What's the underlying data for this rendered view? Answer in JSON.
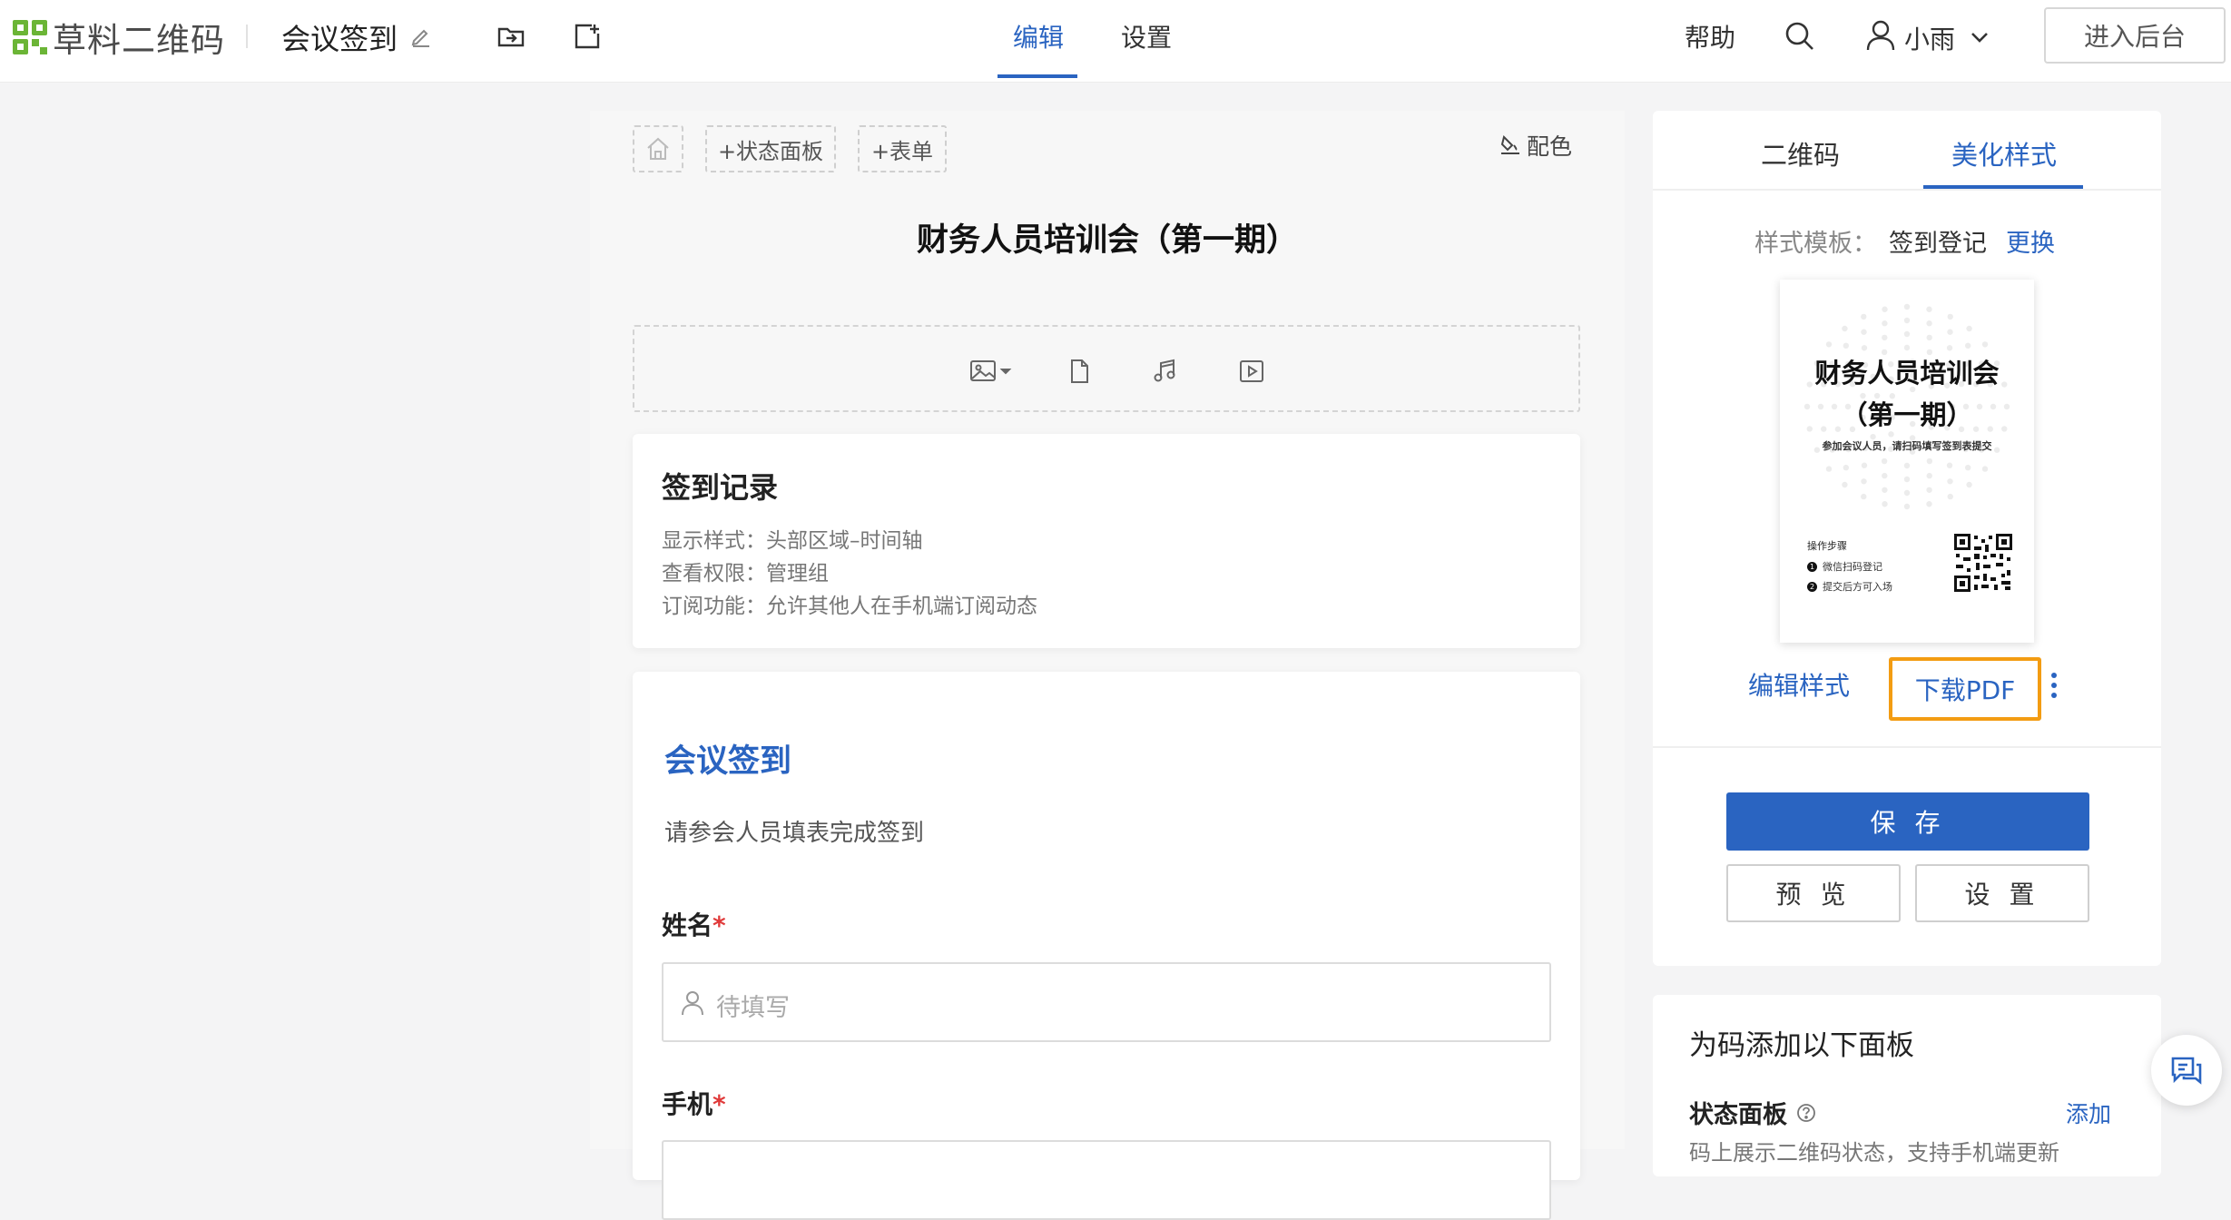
{
  "header": {
    "logo_text": "草料二维码",
    "doc_title": "会议签到",
    "tabs": [
      {
        "label": "编辑",
        "active": true
      },
      {
        "label": "设置",
        "active": false
      }
    ],
    "help": "帮助",
    "user_name": "小雨",
    "backend_button": "进入后台"
  },
  "editor": {
    "toolbar": {
      "status_panel_button": "+状态面板",
      "form_button": "+表单",
      "color_button": "配色"
    },
    "page_title": "财务人员培训会（第一期）",
    "sign_record": {
      "title": "签到记录",
      "lines": [
        "显示样式：头部区域–时间轴",
        "查看权限：管理组",
        "订阅功能：允许其他人在手机端订阅动态"
      ]
    },
    "form": {
      "title": "会议签到",
      "description": "请参会人员填表完成签到",
      "fields": [
        {
          "label": "姓名",
          "required": "*",
          "placeholder": "待填写"
        },
        {
          "label": "手机",
          "required": "*",
          "placeholder": ""
        }
      ]
    }
  },
  "right_panel": {
    "tabs": [
      {
        "label": "二维码",
        "active": false
      },
      {
        "label": "美化样式",
        "active": true
      }
    ],
    "template_label": "样式模板：",
    "template_name": "签到登记",
    "change_link": "更换",
    "poster": {
      "title_line1": "财务人员培训会",
      "title_line2": "（第一期）",
      "subtitle": "参加会议人员，请扫码填写签到表提交",
      "steps_heading": "操作步骤",
      "steps": [
        {
          "num": "1",
          "text": "微信扫码登记"
        },
        {
          "num": "2",
          "text": "提交后方可入场"
        }
      ]
    },
    "edit_style_link": "编辑样式",
    "download_pdf": "下载PDF",
    "save_button": "保 存",
    "preview_button": "预 览",
    "settings_button": "设 置",
    "add_panels_heading": "为码添加以下面板",
    "status_panel_title": "状态面板",
    "add_link": "添加",
    "status_panel_desc": "码上展示二维码状态，支持手机端更新"
  },
  "colors": {
    "accent": "#2a64c1",
    "highlight_border": "#f39c12",
    "required": "#e03a3a"
  }
}
